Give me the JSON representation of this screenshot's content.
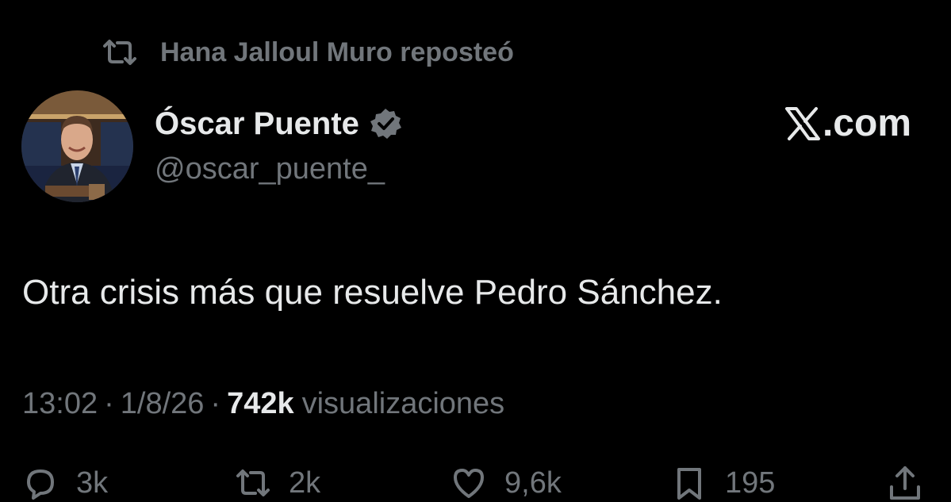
{
  "repost": {
    "text": "Hana Jalloul Muro reposteó",
    "icon": "repost-icon"
  },
  "author": {
    "display_name": "Óscar Puente",
    "handle": "@oscar_puente_",
    "verified": true,
    "verified_color": "#71767b"
  },
  "brand": {
    "text": ".com",
    "icon": "x-logo-icon"
  },
  "tweet": {
    "text": "Otra crisis más que resuelve Pedro Sánchez."
  },
  "meta": {
    "time": "13:02",
    "separator": "·",
    "date": "1/8/26",
    "views_count": "742k",
    "views_label": "visualizaciones"
  },
  "actions": {
    "replies": "3k",
    "reposts": "2k",
    "likes": "9,6k",
    "bookmarks": "195"
  },
  "colors": {
    "background": "#000000",
    "primary_text": "#e7e9ea",
    "secondary_text": "#71767b"
  }
}
